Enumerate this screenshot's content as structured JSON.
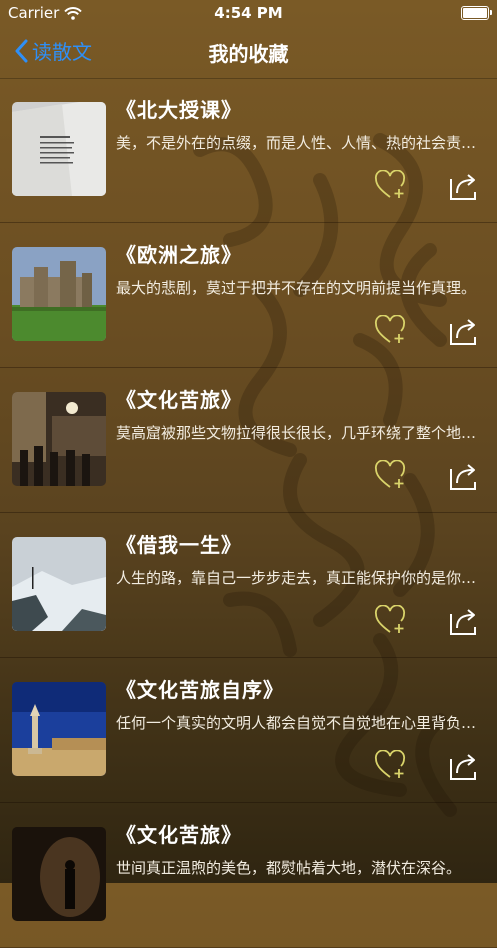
{
  "status_bar": {
    "carrier": "Carrier",
    "time": "4:54 PM"
  },
  "nav": {
    "back_label": "读散文",
    "title": "我的收藏"
  },
  "colors": {
    "accent_blue": "#2f8ff6",
    "heart_color": "#d9d36a",
    "background": "#6b4e22"
  },
  "items": [
    {
      "title": "《北大授课》",
      "excerpt": "美，不是外在的点缀，而是人性、人情、热的社会责任感。",
      "thumbnail": "open-book-photo"
    },
    {
      "title": "《欧洲之旅》",
      "excerpt": "最大的悲剧，莫过于把并不存在的文明前提当作真理。",
      "thumbnail": "castle-photo"
    },
    {
      "title": "《文化苦旅》",
      "excerpt": "莫高窟被那些文物拉得很长很长，几乎环绕了整个地球。",
      "thumbnail": "cave-tourists-photo"
    },
    {
      "title": "《借我一生》",
      "excerpt": "人生的路，靠自己一步步走去，真正能保护你的是你自己。",
      "thumbnail": "snowy-mountain-photo"
    },
    {
      "title": "《文化苦旅自序》",
      "excerpt": "任何一个真实的文明人都会自觉不自觉地在心里背负着。",
      "thumbnail": "pagoda-photo"
    },
    {
      "title": "《文化苦旅》",
      "excerpt": "世间真正温煦的美色，都熨帖着大地，潜伏在深谷。",
      "thumbnail": "dark-figure-photo"
    }
  ]
}
